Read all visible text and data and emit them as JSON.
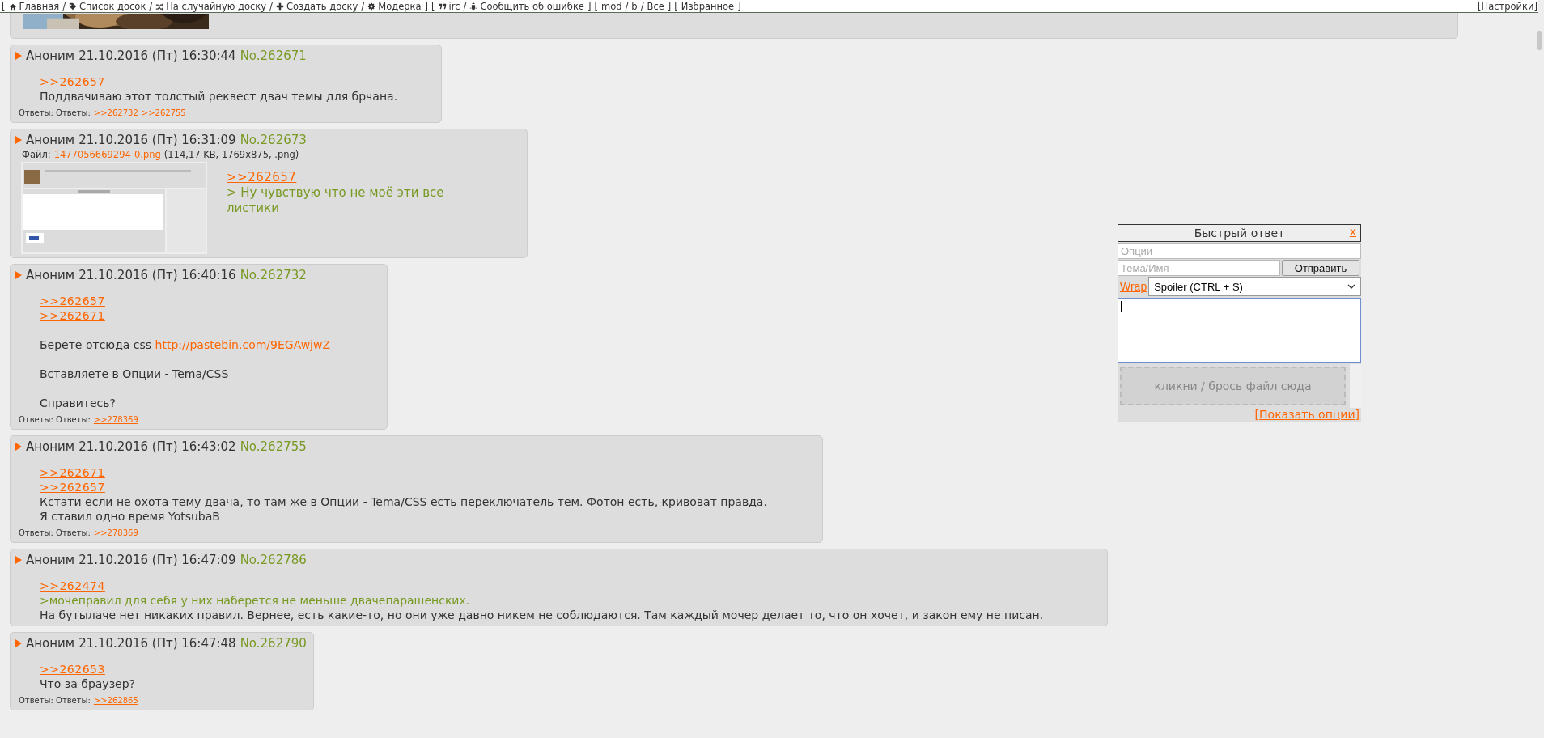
{
  "nav": [
    {
      "kind": "bracket",
      "text": "["
    },
    {
      "kind": "link",
      "label": "Главная"
    },
    {
      "kind": "sep",
      "text": "/"
    },
    {
      "kind": "link",
      "label": "Список досок"
    },
    {
      "kind": "sep",
      "text": "/"
    },
    {
      "kind": "link",
      "label": "На случайную доску"
    },
    {
      "kind": "sep",
      "text": "/"
    },
    {
      "kind": "link",
      "label": "Создать доску"
    },
    {
      "kind": "sep",
      "text": "/"
    },
    {
      "kind": "link",
      "label": "Модерка"
    },
    {
      "kind": "bracket",
      "text": "]"
    },
    {
      "kind": "bracket",
      "text": "["
    },
    {
      "kind": "link",
      "label": "irc"
    },
    {
      "kind": "sep",
      "text": "/"
    },
    {
      "kind": "link",
      "label": "Сообщить об ошибке"
    },
    {
      "kind": "bracket",
      "text": "]"
    },
    {
      "kind": "bracket",
      "text": "["
    },
    {
      "kind": "link",
      "label": "mod"
    },
    {
      "kind": "sep",
      "text": "/"
    },
    {
      "kind": "link",
      "label": "b"
    },
    {
      "kind": "sep",
      "text": "/"
    },
    {
      "kind": "link",
      "label": "Все"
    },
    {
      "kind": "bracket",
      "text": "]"
    },
    {
      "kind": "bracket",
      "text": "["
    },
    {
      "kind": "link",
      "label": "Избранное"
    },
    {
      "kind": "bracket",
      "text": "]"
    }
  ],
  "settings": "[Настройки]",
  "posts": [
    {
      "author": "Аноним",
      "date": "21.10.2016 (Пт) 16:30:44",
      "number": "No.262671",
      "lines": [
        {
          "kind": "reply",
          "text": ">>262657"
        },
        {
          "kind": "text",
          "text": "Поддвачиваю этот толстый реквест двач темы для брчана."
        }
      ],
      "replies": {
        "label": "Ответы: Ответы:",
        "links": [
          ">>262732",
          ">>262755"
        ]
      }
    },
    {
      "author": "Аноним",
      "date": "21.10.2016 (Пт) 16:31:09",
      "number": "No.262673",
      "file": {
        "label": "Файл:",
        "name": "1477056669294-0.png",
        "info": "(114,17 KB, 1769x875, .png)"
      },
      "lines": [
        {
          "kind": "reply",
          "text": ">>262657"
        },
        {
          "kind": "quote",
          "text": "> Ну чувствую что не моё эти все листики"
        }
      ]
    },
    {
      "author": "Аноним",
      "date": "21.10.2016 (Пт) 16:40:16",
      "number": "No.262732",
      "lines": [
        {
          "kind": "reply",
          "text": ">>262657"
        },
        {
          "kind": "reply",
          "text": ">>262671"
        },
        {
          "kind": "text",
          "text": "Берете отсюда css",
          "link": "http://pastebin.com/9EGAwjwZ",
          "gap_before": true
        },
        {
          "kind": "text",
          "text": "Вставляете в Опции - Tema/CSS",
          "gap_before": true
        },
        {
          "kind": "text",
          "text": "Справитесь?",
          "gap_before": true
        }
      ],
      "replies": {
        "label": "Ответы: Ответы:",
        "links": [
          ">>278369"
        ]
      }
    },
    {
      "author": "Аноним",
      "date": "21.10.2016 (Пт) 16:43:02",
      "number": "No.262755",
      "lines": [
        {
          "kind": "reply",
          "text": ">>262671"
        },
        {
          "kind": "reply",
          "text": ">>262657"
        },
        {
          "kind": "text",
          "text": "Кстати если не охота тему двача, то там же в Опции - Tema/CSS есть переключатель тем. Фотон есть, кривоват правда."
        },
        {
          "kind": "text",
          "text": "Я ставил одно время YotsubaB"
        }
      ],
      "replies": {
        "label": "Ответы: Ответы:",
        "links": [
          ">>278369"
        ]
      }
    },
    {
      "author": "Аноним",
      "date": "21.10.2016 (Пт) 16:47:09",
      "number": "No.262786",
      "lines": [
        {
          "kind": "reply",
          "text": ">>262474"
        },
        {
          "kind": "quote",
          "text": ">мочеправил для себя у них наберется не меньше двачепарашенских."
        },
        {
          "kind": "text",
          "text": "На бутылаче нет никаких правил. Вернее, есть какие-то, но они уже давно никем не соблюдаются. Там каждый мочер делает то, что он хочет, и закон ему не писан."
        }
      ]
    },
    {
      "author": "Аноним",
      "date": "21.10.2016 (Пт) 16:47:48",
      "number": "No.262790",
      "lines": [
        {
          "kind": "reply",
          "text": ">>262653"
        },
        {
          "kind": "text",
          "text": "Что за браузер?"
        }
      ],
      "replies": {
        "label": "Ответы: Ответы:",
        "links": [
          ">>262865"
        ]
      }
    }
  ],
  "quick_reply": {
    "title": "Быстрый ответ",
    "close": "x",
    "options_placeholder": "Опции",
    "name_placeholder": "Тема/Имя",
    "submit": "Отправить",
    "wrap": "Wrap",
    "markup": "Spoiler (CTRL + S)",
    "dropzone": "кликни / брось файл сюда",
    "show_options": "[Показать опции]"
  }
}
